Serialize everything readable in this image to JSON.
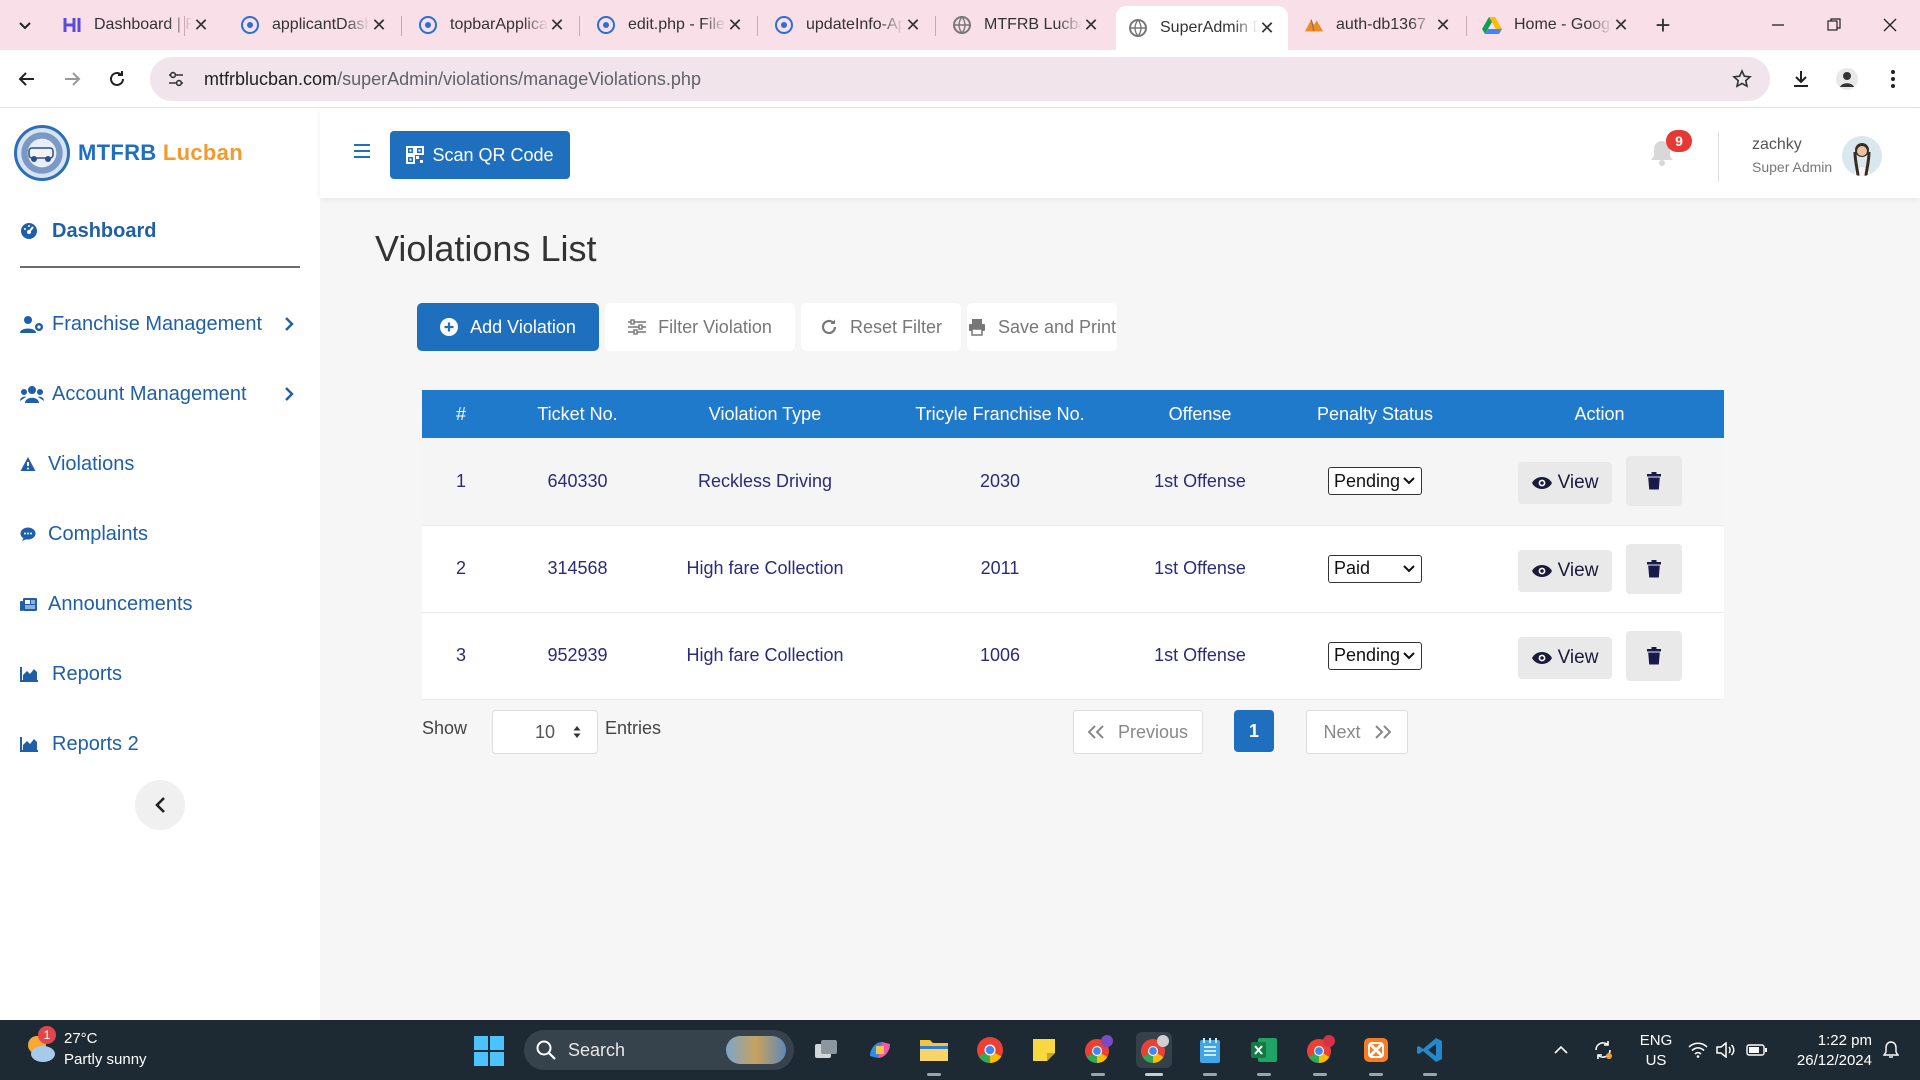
{
  "browser": {
    "tabs": [
      {
        "label": "Dashboard | FrankCo",
        "icon": "h-logo-icon",
        "active": false
      },
      {
        "label": "applicantDashboard",
        "icon": "php-file-icon",
        "active": false
      },
      {
        "label": "topbarApplicant",
        "icon": "php-file-icon",
        "active": false
      },
      {
        "label": "edit.php - File Manager",
        "icon": "php-file-icon",
        "active": false
      },
      {
        "label": "updateInfo-Applicant",
        "icon": "php-file-icon",
        "active": false
      },
      {
        "label": "MTFRB Lucban",
        "icon": "globe-icon",
        "active": false
      },
      {
        "label": "SuperAdmin Dashboard",
        "icon": "globe-icon",
        "active": true
      },
      {
        "label": "auth-db1367",
        "icon": "phpmyadmin-icon",
        "active": false
      },
      {
        "label": "Home - Google Drive",
        "icon": "google-drive-icon",
        "active": false
      }
    ],
    "tab_close_glyph": "✕",
    "new_tab_glyph": "+",
    "url_domain": "mtfrblucban.com",
    "url_path": "/superAdmin/violations/manageViolations.php"
  },
  "sidebar": {
    "brand_part1": "MTFRB",
    "brand_part2": "Lucban",
    "items": [
      {
        "label": "Dashboard",
        "icon": "dashboard-gauge-icon",
        "has_chevron": false
      },
      {
        "label": "Franchise Management",
        "icon": "user-gear-icon",
        "has_chevron": true
      },
      {
        "label": "Account Management",
        "icon": "users-icon",
        "has_chevron": true
      },
      {
        "label": "Violations",
        "icon": "warning-icon",
        "has_chevron": false
      },
      {
        "label": "Complaints",
        "icon": "comment-icon",
        "has_chevron": false
      },
      {
        "label": "Announcements",
        "icon": "newspaper-icon",
        "has_chevron": false
      },
      {
        "label": "Reports",
        "icon": "chart-area-icon",
        "has_chevron": false
      },
      {
        "label": "Reports 2",
        "icon": "chart-area-icon",
        "has_chevron": false
      }
    ]
  },
  "topbar": {
    "scan_label": "Scan QR Code",
    "notification_count": "9",
    "user_name": "zachky",
    "user_role": "Super Admin"
  },
  "page": {
    "title": "Violations List",
    "actions": {
      "add": "Add Violation",
      "filter": "Filter Violation",
      "reset": "Reset Filter",
      "print": "Save and Print"
    }
  },
  "table": {
    "headers": [
      "#",
      "Ticket No.",
      "Violation Type",
      "Tricyle Franchise No.",
      "Offense",
      "Penalty Status",
      "Action"
    ],
    "rows": [
      {
        "num": "1",
        "ticket": "640330",
        "type": "Reckless Driving",
        "franchise": "2030",
        "offense": "1st Offense",
        "penalty": "Pending"
      },
      {
        "num": "2",
        "ticket": "314568",
        "type": "High fare Collection",
        "franchise": "2011",
        "offense": "1st Offense",
        "penalty": "Paid"
      },
      {
        "num": "3",
        "ticket": "952939",
        "type": "High fare Collection",
        "franchise": "1006",
        "offense": "1st Offense",
        "penalty": "Pending"
      }
    ],
    "view_label": "View"
  },
  "pagination": {
    "show_label": "Show",
    "entries_value": "10",
    "entries_label": "Entries",
    "previous": "Previous",
    "current_page": "1",
    "next": "Next"
  },
  "taskbar": {
    "weather_badge": "1",
    "temperature": "27°C",
    "weather_desc": "Partly sunny",
    "search_label": "Search",
    "lang": "ENG",
    "region": "US",
    "time": "1:22 pm",
    "date": "26/12/2024"
  },
  "colors": {
    "primary": "#1f6fbf",
    "table_header": "#1f7acb",
    "brand_orange": "#f39a2d",
    "badge_red": "#e53935",
    "tab_strip": "#f9dfe8",
    "taskbar": "#1e2a33"
  }
}
